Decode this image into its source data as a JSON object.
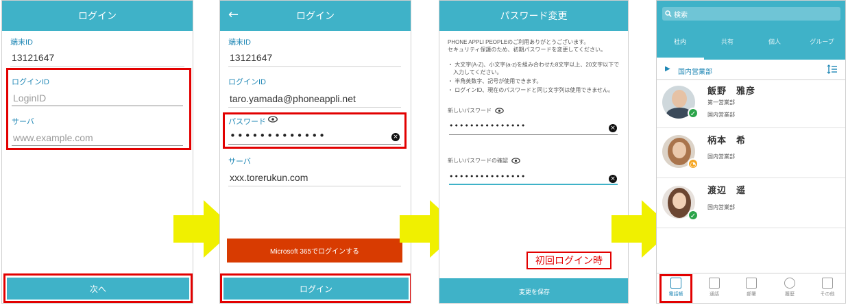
{
  "screen1": {
    "title": "ログイン",
    "terminal_label": "端末ID",
    "terminal_value": "13121647",
    "login_label": "ログインID",
    "login_placeholder": "LoginID",
    "server_label": "サーバ",
    "server_placeholder": "www.example.com",
    "next_button": "次へ"
  },
  "screen2": {
    "title": "ログイン",
    "back_icon": "arrow-left-icon",
    "terminal_label": "端末ID",
    "terminal_value": "13121647",
    "login_label": "ログインID",
    "login_value": "taro.yamada@phoneappli.net",
    "password_label": "パスワード",
    "password_value": "•••••••••••••",
    "server_label": "サーバ",
    "server_value": "xxx.torerukun.com",
    "ms_button": "Microsoft 365でログインする",
    "login_button": "ログイン"
  },
  "screen3": {
    "title": "パスワード変更",
    "intro_line1": "PHONE APPLI PEOPLEのご利用ありがとうございます。",
    "intro_line2": "セキュリティ保護のため、初期パスワードを変更してください。",
    "rule1_line1": "・ 大文字(A-Z)、小文字(a-z)を組み合わせた8文字以上、20文字以下で",
    "rule1_line2": "入力してください。",
    "rule2": "・ 半角英数字、記号が使用できます。",
    "rule3": "・ ログインID、現在のパスワードと同じ文字列は使用できません。",
    "new_pw_label": "新しいパスワード",
    "new_pw_value": "•••••••••••••••",
    "confirm_pw_label": "新しいパスワードの確認",
    "confirm_pw_value": "•••••••••••••••",
    "first_login_note": "初回ログイン時",
    "save_button": "変更を保存"
  },
  "screen4": {
    "search_placeholder": "検索",
    "tabs": [
      "社内",
      "共有",
      "個人",
      "グループ"
    ],
    "department": "国内営業部",
    "contacts": [
      {
        "name": "飯野　雅彦",
        "sub1": "第一営業部",
        "sub2": "国内営業部",
        "status": "check"
      },
      {
        "name": "柄本　希",
        "sub1": "国内営業部",
        "sub2": "",
        "status": "clock"
      },
      {
        "name": "渡辺　遥",
        "sub1": "国内営業部",
        "sub2": "",
        "status": "check"
      }
    ],
    "nav": [
      "電話帳",
      "通話",
      "部署",
      "履歴",
      "その他"
    ]
  },
  "colors": {
    "teal": "#3fb2c8",
    "red": "#e20000",
    "ms_orange": "#d83b01",
    "arrow_yellow": "#f0f000",
    "status_green": "#2ba44a",
    "status_orange": "#f5a623"
  }
}
